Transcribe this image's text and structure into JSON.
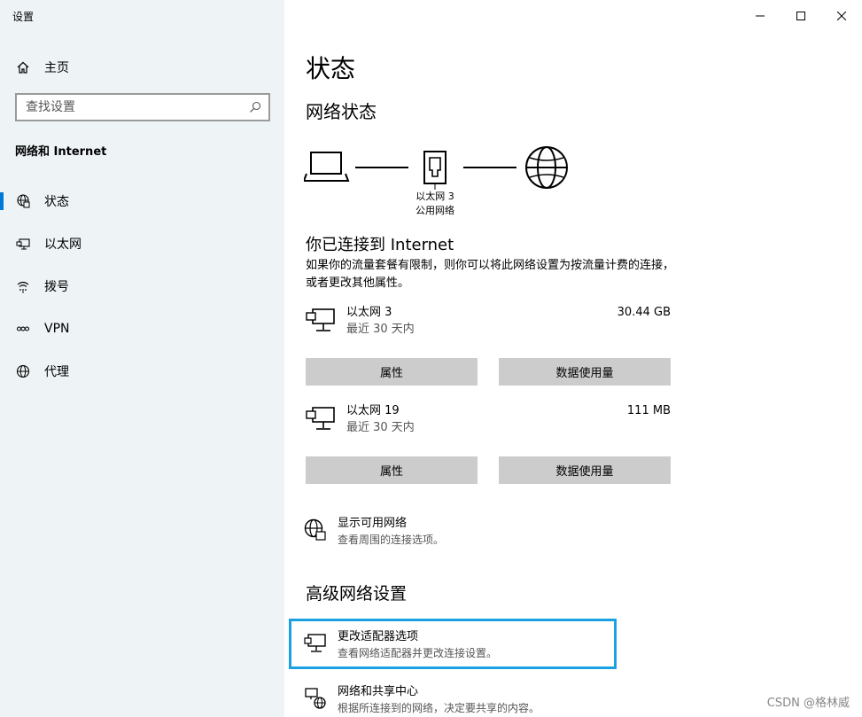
{
  "window": {
    "title": "设置",
    "minimize_label": "minimize",
    "maximize_label": "maximize",
    "close_label": "close"
  },
  "sidebar": {
    "home_label": "主页",
    "search_placeholder": "查找设置",
    "section_heading": "网络和 Internet",
    "items": [
      {
        "label": "状态",
        "icon": "globe-status-icon",
        "active": true
      },
      {
        "label": "以太网",
        "icon": "ethernet-icon",
        "active": false
      },
      {
        "label": "拨号",
        "icon": "dialup-icon",
        "active": false
      },
      {
        "label": "VPN",
        "icon": "vpn-icon",
        "active": false
      },
      {
        "label": "代理",
        "icon": "proxy-globe-icon",
        "active": false
      }
    ]
  },
  "main": {
    "page_title": "状态",
    "network_status_heading": "网络状态",
    "diagram": {
      "adapter_name": "以太网 3",
      "network_type": "公用网络"
    },
    "connected_title": "你已连接到 Internet",
    "connected_desc": "如果你的流量套餐有限制，则你可以将此网络设置为按流量计费的连接，或者更改其他属性。",
    "adapters": [
      {
        "name": "以太网 3",
        "usage_period": "最近 30 天内",
        "data_used": "30.44 GB",
        "properties_label": "属性",
        "data_usage_label": "数据使用量"
      },
      {
        "name": "以太网 19",
        "usage_period": "最近 30 天内",
        "data_used": "111 MB",
        "properties_label": "属性",
        "data_usage_label": "数据使用量"
      }
    ],
    "show_networks": {
      "title": "显示可用网络",
      "desc": "查看周围的连接选项。"
    },
    "advanced_heading": "高级网络设置",
    "change_adapter": {
      "title": "更改适配器选项",
      "desc": "查看网络适配器并更改连接设置。"
    },
    "sharing_center": {
      "title": "网络和共享中心",
      "desc": "根据所连接到的网络，决定要共享的内容。"
    }
  },
  "watermark": "CSDN @格林威",
  "colors": {
    "sidebar_bg": "#eef3f6",
    "accent": "#0078d7",
    "highlight": "#1ba1e2",
    "button_bg": "#cccccc"
  }
}
